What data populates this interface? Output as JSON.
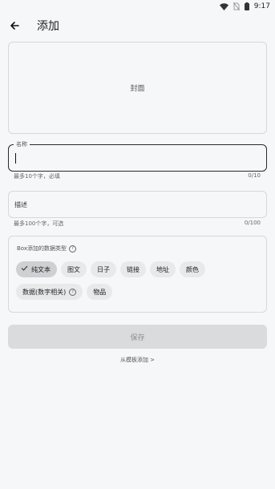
{
  "status": {
    "time": "9:17"
  },
  "header": {
    "title": "添加"
  },
  "cover": {
    "label": "封面"
  },
  "name_field": {
    "label": "名称",
    "helper": "最多10个字，必填",
    "counter": "0/10"
  },
  "desc_field": {
    "placeholder": "描述",
    "helper": "最多100个字，可选",
    "counter": "0/100"
  },
  "types": {
    "title": "Box添加的数据类型",
    "help_glyph": "?",
    "chips": [
      {
        "label": "纯文本",
        "selected": true
      },
      {
        "label": "图文"
      },
      {
        "label": "日子"
      },
      {
        "label": "链接"
      },
      {
        "label": "地址"
      },
      {
        "label": "颜色"
      },
      {
        "label": "数据(数字相关)"
      },
      {
        "label": "物品"
      }
    ]
  },
  "save_button": {
    "label": "保存"
  },
  "template_link": {
    "label": "从模板添加 >"
  },
  "colors": {
    "background": "#f6f7f9",
    "chip": "#e8e9eb",
    "chip_selected": "#cfd0d3",
    "save_disabled": "#dadbdd"
  }
}
